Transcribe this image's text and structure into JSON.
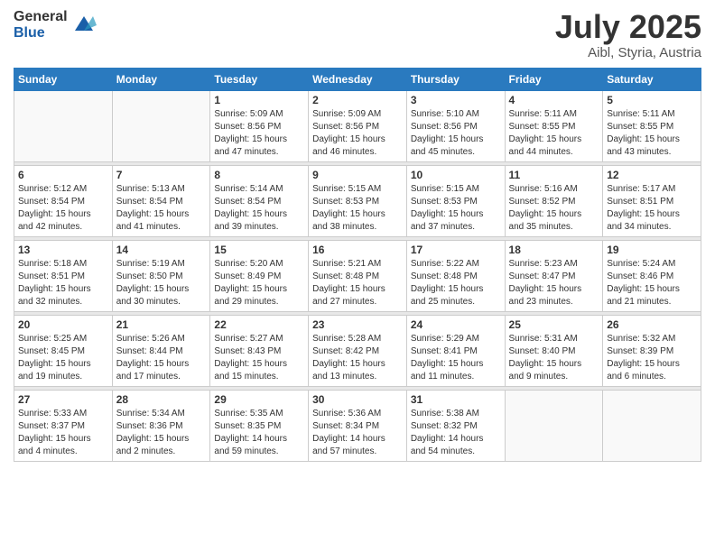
{
  "logo": {
    "general": "General",
    "blue": "Blue"
  },
  "header": {
    "month": "July 2025",
    "location": "Aibl, Styria, Austria"
  },
  "weekdays": [
    "Sunday",
    "Monday",
    "Tuesday",
    "Wednesday",
    "Thursday",
    "Friday",
    "Saturday"
  ],
  "weeks": [
    [
      {
        "day": "",
        "sunrise": "",
        "sunset": "",
        "daylight": ""
      },
      {
        "day": "",
        "sunrise": "",
        "sunset": "",
        "daylight": ""
      },
      {
        "day": "1",
        "sunrise": "Sunrise: 5:09 AM",
        "sunset": "Sunset: 8:56 PM",
        "daylight": "Daylight: 15 hours and 47 minutes."
      },
      {
        "day": "2",
        "sunrise": "Sunrise: 5:09 AM",
        "sunset": "Sunset: 8:56 PM",
        "daylight": "Daylight: 15 hours and 46 minutes."
      },
      {
        "day": "3",
        "sunrise": "Sunrise: 5:10 AM",
        "sunset": "Sunset: 8:56 PM",
        "daylight": "Daylight: 15 hours and 45 minutes."
      },
      {
        "day": "4",
        "sunrise": "Sunrise: 5:11 AM",
        "sunset": "Sunset: 8:55 PM",
        "daylight": "Daylight: 15 hours and 44 minutes."
      },
      {
        "day": "5",
        "sunrise": "Sunrise: 5:11 AM",
        "sunset": "Sunset: 8:55 PM",
        "daylight": "Daylight: 15 hours and 43 minutes."
      }
    ],
    [
      {
        "day": "6",
        "sunrise": "Sunrise: 5:12 AM",
        "sunset": "Sunset: 8:54 PM",
        "daylight": "Daylight: 15 hours and 42 minutes."
      },
      {
        "day": "7",
        "sunrise": "Sunrise: 5:13 AM",
        "sunset": "Sunset: 8:54 PM",
        "daylight": "Daylight: 15 hours and 41 minutes."
      },
      {
        "day": "8",
        "sunrise": "Sunrise: 5:14 AM",
        "sunset": "Sunset: 8:54 PM",
        "daylight": "Daylight: 15 hours and 39 minutes."
      },
      {
        "day": "9",
        "sunrise": "Sunrise: 5:15 AM",
        "sunset": "Sunset: 8:53 PM",
        "daylight": "Daylight: 15 hours and 38 minutes."
      },
      {
        "day": "10",
        "sunrise": "Sunrise: 5:15 AM",
        "sunset": "Sunset: 8:53 PM",
        "daylight": "Daylight: 15 hours and 37 minutes."
      },
      {
        "day": "11",
        "sunrise": "Sunrise: 5:16 AM",
        "sunset": "Sunset: 8:52 PM",
        "daylight": "Daylight: 15 hours and 35 minutes."
      },
      {
        "day": "12",
        "sunrise": "Sunrise: 5:17 AM",
        "sunset": "Sunset: 8:51 PM",
        "daylight": "Daylight: 15 hours and 34 minutes."
      }
    ],
    [
      {
        "day": "13",
        "sunrise": "Sunrise: 5:18 AM",
        "sunset": "Sunset: 8:51 PM",
        "daylight": "Daylight: 15 hours and 32 minutes."
      },
      {
        "day": "14",
        "sunrise": "Sunrise: 5:19 AM",
        "sunset": "Sunset: 8:50 PM",
        "daylight": "Daylight: 15 hours and 30 minutes."
      },
      {
        "day": "15",
        "sunrise": "Sunrise: 5:20 AM",
        "sunset": "Sunset: 8:49 PM",
        "daylight": "Daylight: 15 hours and 29 minutes."
      },
      {
        "day": "16",
        "sunrise": "Sunrise: 5:21 AM",
        "sunset": "Sunset: 8:48 PM",
        "daylight": "Daylight: 15 hours and 27 minutes."
      },
      {
        "day": "17",
        "sunrise": "Sunrise: 5:22 AM",
        "sunset": "Sunset: 8:48 PM",
        "daylight": "Daylight: 15 hours and 25 minutes."
      },
      {
        "day": "18",
        "sunrise": "Sunrise: 5:23 AM",
        "sunset": "Sunset: 8:47 PM",
        "daylight": "Daylight: 15 hours and 23 minutes."
      },
      {
        "day": "19",
        "sunrise": "Sunrise: 5:24 AM",
        "sunset": "Sunset: 8:46 PM",
        "daylight": "Daylight: 15 hours and 21 minutes."
      }
    ],
    [
      {
        "day": "20",
        "sunrise": "Sunrise: 5:25 AM",
        "sunset": "Sunset: 8:45 PM",
        "daylight": "Daylight: 15 hours and 19 minutes."
      },
      {
        "day": "21",
        "sunrise": "Sunrise: 5:26 AM",
        "sunset": "Sunset: 8:44 PM",
        "daylight": "Daylight: 15 hours and 17 minutes."
      },
      {
        "day": "22",
        "sunrise": "Sunrise: 5:27 AM",
        "sunset": "Sunset: 8:43 PM",
        "daylight": "Daylight: 15 hours and 15 minutes."
      },
      {
        "day": "23",
        "sunrise": "Sunrise: 5:28 AM",
        "sunset": "Sunset: 8:42 PM",
        "daylight": "Daylight: 15 hours and 13 minutes."
      },
      {
        "day": "24",
        "sunrise": "Sunrise: 5:29 AM",
        "sunset": "Sunset: 8:41 PM",
        "daylight": "Daylight: 15 hours and 11 minutes."
      },
      {
        "day": "25",
        "sunrise": "Sunrise: 5:31 AM",
        "sunset": "Sunset: 8:40 PM",
        "daylight": "Daylight: 15 hours and 9 minutes."
      },
      {
        "day": "26",
        "sunrise": "Sunrise: 5:32 AM",
        "sunset": "Sunset: 8:39 PM",
        "daylight": "Daylight: 15 hours and 6 minutes."
      }
    ],
    [
      {
        "day": "27",
        "sunrise": "Sunrise: 5:33 AM",
        "sunset": "Sunset: 8:37 PM",
        "daylight": "Daylight: 15 hours and 4 minutes."
      },
      {
        "day": "28",
        "sunrise": "Sunrise: 5:34 AM",
        "sunset": "Sunset: 8:36 PM",
        "daylight": "Daylight: 15 hours and 2 minutes."
      },
      {
        "day": "29",
        "sunrise": "Sunrise: 5:35 AM",
        "sunset": "Sunset: 8:35 PM",
        "daylight": "Daylight: 14 hours and 59 minutes."
      },
      {
        "day": "30",
        "sunrise": "Sunrise: 5:36 AM",
        "sunset": "Sunset: 8:34 PM",
        "daylight": "Daylight: 14 hours and 57 minutes."
      },
      {
        "day": "31",
        "sunrise": "Sunrise: 5:38 AM",
        "sunset": "Sunset: 8:32 PM",
        "daylight": "Daylight: 14 hours and 54 minutes."
      },
      {
        "day": "",
        "sunrise": "",
        "sunset": "",
        "daylight": ""
      },
      {
        "day": "",
        "sunrise": "",
        "sunset": "",
        "daylight": ""
      }
    ]
  ]
}
